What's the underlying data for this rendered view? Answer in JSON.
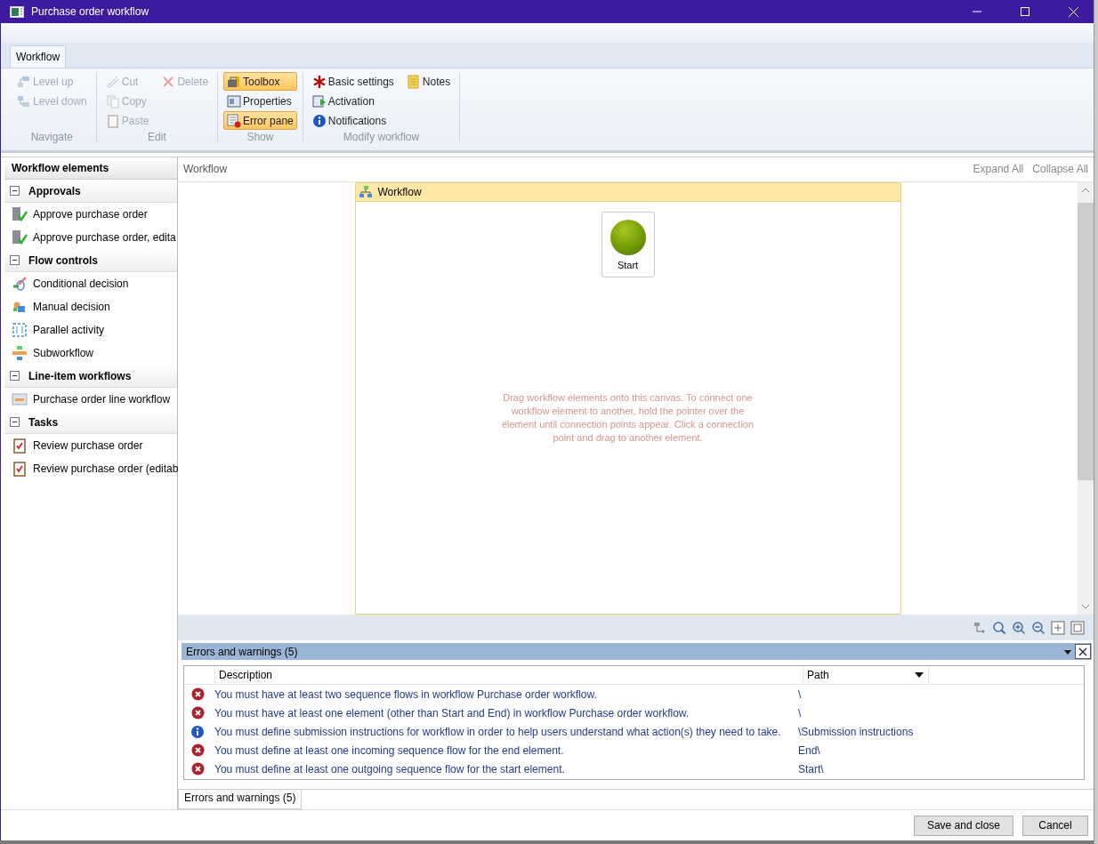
{
  "window": {
    "title": "Purchase order workflow"
  },
  "tabs": [
    {
      "label": "Workflow",
      "selected": true
    }
  ],
  "ribbon": [
    {
      "label": "Navigate",
      "columns": [
        [
          {
            "kind": "level-up",
            "label": "Level up",
            "disabled": true,
            "selected": false
          },
          {
            "kind": "level-down",
            "label": "Level down",
            "disabled": true,
            "selected": false
          }
        ]
      ]
    },
    {
      "label": "Edit",
      "columns": [
        [
          {
            "kind": "cut",
            "label": "Cut",
            "disabled": true,
            "selected": false
          },
          {
            "kind": "copy",
            "label": "Copy",
            "disabled": true,
            "selected": false
          },
          {
            "kind": "paste",
            "label": "Paste",
            "disabled": true,
            "selected": false
          }
        ],
        [
          {
            "kind": "delete",
            "label": "Delete",
            "disabled": true,
            "selected": false
          }
        ]
      ]
    },
    {
      "label": "Show",
      "columns": [
        [
          {
            "kind": "toolbox",
            "label": "Toolbox",
            "disabled": false,
            "selected": true
          },
          {
            "kind": "properties",
            "label": "Properties",
            "disabled": false,
            "selected": false
          },
          {
            "kind": "error-pane",
            "label": "Error pane",
            "disabled": false,
            "selected": true
          }
        ]
      ]
    },
    {
      "label": "Modify workflow",
      "columns": [
        [
          {
            "kind": "asterisk",
            "label": "Basic settings",
            "disabled": false,
            "selected": false
          },
          {
            "kind": "activation",
            "label": "Activation",
            "disabled": false,
            "selected": false
          },
          {
            "kind": "info",
            "label": "Notifications",
            "disabled": false,
            "selected": false
          }
        ],
        [
          {
            "kind": "notes",
            "label": "Notes",
            "disabled": false,
            "selected": false
          }
        ]
      ]
    }
  ],
  "sidebar": {
    "title": "Workflow elements",
    "groups": [
      {
        "label": "Approvals",
        "expanded": true,
        "items": [
          {
            "kind": "approve",
            "label": "Approve purchase order"
          },
          {
            "kind": "approve",
            "label": "Approve purchase order, edita"
          }
        ]
      },
      {
        "label": "Flow controls",
        "expanded": true,
        "items": [
          {
            "kind": "conditional",
            "label": "Conditional decision"
          },
          {
            "kind": "manual",
            "label": "Manual decision"
          },
          {
            "kind": "parallel",
            "label": "Parallel activity"
          },
          {
            "kind": "subworkflow",
            "label": "Subworkflow"
          }
        ]
      },
      {
        "label": "Line-item workflows",
        "expanded": true,
        "items": [
          {
            "kind": "line",
            "label": "Purchase order line workflow"
          }
        ]
      },
      {
        "label": "Tasks",
        "expanded": true,
        "items": [
          {
            "kind": "task",
            "label": "Review purchase order"
          },
          {
            "kind": "task",
            "label": "Review purchase order (editab"
          }
        ]
      }
    ]
  },
  "canvas": {
    "breadcrumb": "Workflow",
    "links": [
      "Expand All",
      "Collapse All"
    ],
    "container_title": "Workflow",
    "start_label": "Start",
    "hint": "Drag workflow elements onto this canvas. To connect one workflow element to another, hold the pointer over the element until connection points appear.  Click a connection point and drag to another element."
  },
  "errors": {
    "title": "Errors and warnings (5)",
    "columns": [
      "Description",
      "Path"
    ],
    "rows": [
      {
        "kind": "error",
        "description": "You must have at least two sequence flows in workflow Purchase order workflow.",
        "path": "\\"
      },
      {
        "kind": "error",
        "description": "You must have at least one element (other than Start and End) in workflow Purchase order workflow.",
        "path": "\\"
      },
      {
        "kind": "info",
        "description": "You must define submission instructions for workflow  in order to help users understand what action(s) they need to take.",
        "path": "\\Submission instructions"
      },
      {
        "kind": "error",
        "description": "You must define at least one incoming sequence flow for the end element.",
        "path": "End\\"
      },
      {
        "kind": "error",
        "description": "You must define at least one outgoing sequence flow for the start element.",
        "path": "Start\\"
      }
    ],
    "tab": "Errors and warnings (5)"
  },
  "buttons": [
    "Save and close",
    "Cancel"
  ]
}
